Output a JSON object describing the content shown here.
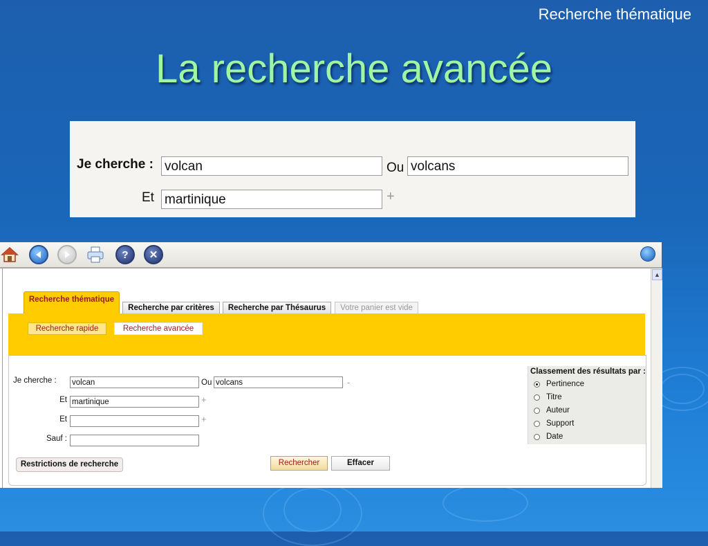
{
  "slide": {
    "header": "Recherche thématique",
    "title": "La recherche avancée"
  },
  "zoom": {
    "je_cherche_label": "Je cherche :",
    "field1_value": "volcan",
    "ou_label": "Ou",
    "field2_value": "volcans",
    "et_label": "Et",
    "field3_value": "martinique",
    "plus": "+"
  },
  "toolbar": {
    "icons": [
      "home-icon",
      "back-icon",
      "forward-icon",
      "print-icon",
      "help-icon",
      "close-icon",
      "globe-icon"
    ]
  },
  "tabs": {
    "active": "Recherche thématique",
    "criteria": "Recherche par critères",
    "thesaurus": "Recherche par Thésaurus",
    "cart": "Votre panier est vide"
  },
  "subtabs": {
    "rapide": "Recherche rapide",
    "avancee": "Recherche avancée"
  },
  "form": {
    "je_cherche_label": "Je cherche :",
    "field1_value": "volcan",
    "ou_label": "Ou",
    "field2_value": "volcans",
    "minus": "-",
    "et1_label": "Et",
    "field3_value": "martinique",
    "et2_label": "Et",
    "field4_value": "",
    "sauf_label": "Sauf :",
    "field5_value": "",
    "plus": "+"
  },
  "sort": {
    "title": "Classement des résultats par :",
    "options": [
      "Pertinence",
      "Titre",
      "Auteur",
      "Support",
      "Date"
    ],
    "selected": "Pertinence"
  },
  "buttons": {
    "restrictions": "Restrictions de recherche",
    "search": "Rechercher",
    "clear": "Effacer"
  }
}
